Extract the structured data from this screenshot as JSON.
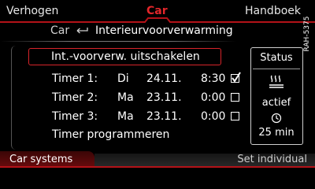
{
  "top_menu": {
    "left": "Verhogen",
    "center": "Car",
    "right": "Handboek"
  },
  "side_ref": "RAH-5375",
  "breadcrumb": {
    "parent": "Car",
    "title": "Interieurvoorverwarming"
  },
  "menu": {
    "selected_item": "Int.-voorverw. uitschakelen",
    "timers": [
      {
        "name": "Timer 1:",
        "day": "Di",
        "date": "24.11.",
        "time": "8:30",
        "checked": true
      },
      {
        "name": "Timer 2:",
        "day": "Ma",
        "date": "23.11.",
        "time": "0:00",
        "checked": false
      },
      {
        "name": "Timer 3:",
        "day": "Ma",
        "date": "23.11.",
        "time": "0:00",
        "checked": false
      }
    ],
    "program_item": "Timer programmeren"
  },
  "status": {
    "title": "Status",
    "state": "actief",
    "duration": "25 min",
    "heat_icon": "seat-heating-icon",
    "clock_icon": "clock-icon"
  },
  "bottom_tabs": {
    "left": "Car systems",
    "right": "Set individual"
  },
  "colors": {
    "accent_red": "#e2262a",
    "line_red": "#b31218"
  }
}
